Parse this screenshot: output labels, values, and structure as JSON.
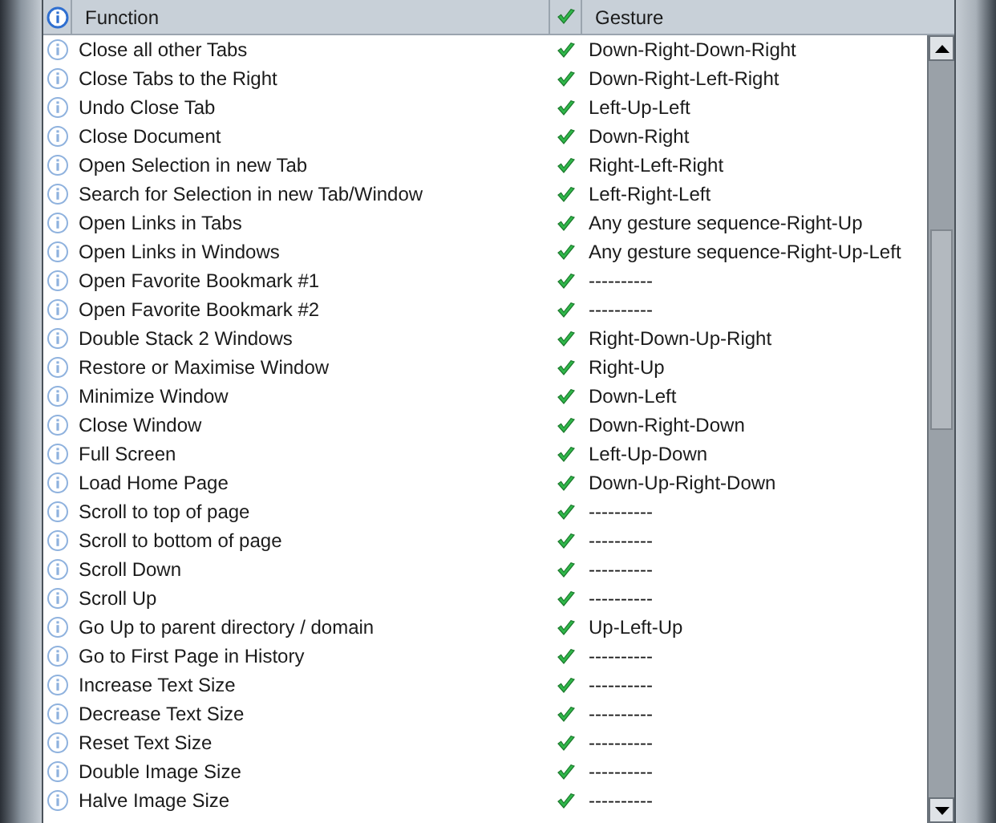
{
  "table": {
    "columns": [
      "Function",
      "Gesture"
    ],
    "rows": [
      {
        "function": "Close all other Tabs",
        "enabled": true,
        "gesture": "Down-Right-Down-Right"
      },
      {
        "function": "Close Tabs to the Right",
        "enabled": true,
        "gesture": "Down-Right-Left-Right"
      },
      {
        "function": "Undo Close Tab",
        "enabled": true,
        "gesture": "Left-Up-Left"
      },
      {
        "function": "Close Document",
        "enabled": true,
        "gesture": "Down-Right"
      },
      {
        "function": "Open Selection in new Tab",
        "enabled": true,
        "gesture": "Right-Left-Right"
      },
      {
        "function": "Search for Selection in new Tab/Window",
        "enabled": true,
        "gesture": "Left-Right-Left"
      },
      {
        "function": "Open Links in Tabs",
        "enabled": true,
        "gesture": "Any gesture sequence-Right-Up"
      },
      {
        "function": "Open Links in Windows",
        "enabled": true,
        "gesture": "Any gesture sequence-Right-Up-Left"
      },
      {
        "function": "Open Favorite Bookmark #1",
        "enabled": true,
        "gesture": "----------"
      },
      {
        "function": "Open Favorite Bookmark #2",
        "enabled": true,
        "gesture": "----------"
      },
      {
        "function": "Double Stack 2 Windows",
        "enabled": true,
        "gesture": "Right-Down-Up-Right"
      },
      {
        "function": "Restore or Maximise Window",
        "enabled": true,
        "gesture": "Right-Up"
      },
      {
        "function": "Minimize Window",
        "enabled": true,
        "gesture": "Down-Left"
      },
      {
        "function": "Close Window",
        "enabled": true,
        "gesture": "Down-Right-Down"
      },
      {
        "function": "Full Screen",
        "enabled": true,
        "gesture": "Left-Up-Down"
      },
      {
        "function": "Load Home Page",
        "enabled": true,
        "gesture": "Down-Up-Right-Down"
      },
      {
        "function": "Scroll to top of page",
        "enabled": true,
        "gesture": "----------"
      },
      {
        "function": "Scroll to bottom of page",
        "enabled": true,
        "gesture": "----------"
      },
      {
        "function": "Scroll Down",
        "enabled": true,
        "gesture": "----------"
      },
      {
        "function": "Scroll Up",
        "enabled": true,
        "gesture": "----------"
      },
      {
        "function": "Go Up to parent directory / domain",
        "enabled": true,
        "gesture": "Up-Left-Up"
      },
      {
        "function": "Go to First Page in History",
        "enabled": true,
        "gesture": "----------"
      },
      {
        "function": "Increase Text Size",
        "enabled": true,
        "gesture": "----------"
      },
      {
        "function": "Decrease Text Size",
        "enabled": true,
        "gesture": "----------"
      },
      {
        "function": "Reset Text Size",
        "enabled": true,
        "gesture": "----------"
      },
      {
        "function": "Double Image Size",
        "enabled": true,
        "gesture": "----------"
      },
      {
        "function": "Halve Image Size",
        "enabled": true,
        "gesture": "----------"
      }
    ]
  }
}
